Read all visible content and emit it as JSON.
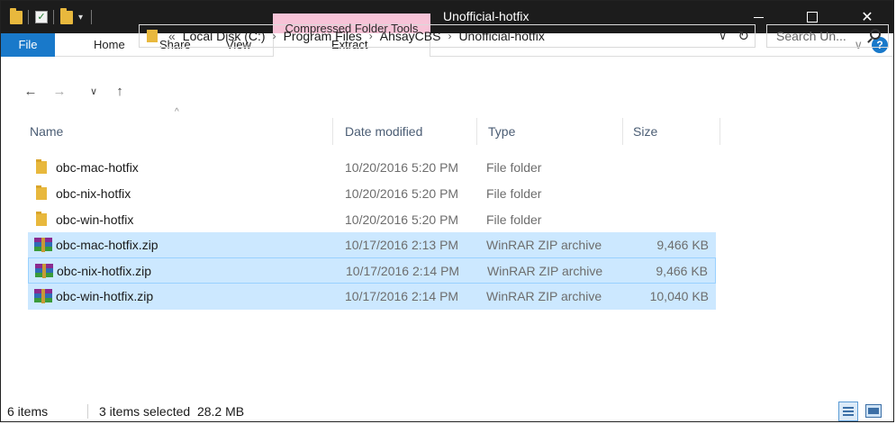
{
  "titlebar": {
    "context_tab_label": "Compressed Folder Tools",
    "window_title": "Unofficial-hotfix",
    "minimize_glyph": "",
    "maximize_glyph": "",
    "close_glyph": "✕"
  },
  "ribbon": {
    "tabs": [
      {
        "label": "File"
      },
      {
        "label": "Home"
      },
      {
        "label": "Share"
      },
      {
        "label": "View"
      },
      {
        "label": "Extract"
      }
    ],
    "expand_glyph": "∨",
    "help_glyph": "?"
  },
  "nav": {
    "back_glyph": "←",
    "forward_glyph": "→",
    "recent_glyph": "∨",
    "up_glyph": "↑",
    "overflow_glyph": "«",
    "breadcrumbs": [
      "Local Disk (C:)",
      "Program Files",
      "AhsayCBS",
      "Unofficial-hotfix"
    ],
    "crumb_sep": "›",
    "dropdown_glyph": "∨",
    "refresh_glyph": "↻",
    "search_placeholder": "Search Un..."
  },
  "columns": {
    "name": "Name",
    "date": "Date modified",
    "type": "Type",
    "size": "Size",
    "sort_glyph": "^"
  },
  "files": [
    {
      "name": "obc-mac-hotfix",
      "date": "10/20/2016 5:20 PM",
      "type": "File folder",
      "size": "",
      "icon": "folder-icon",
      "selected": false
    },
    {
      "name": "obc-nix-hotfix",
      "date": "10/20/2016 5:20 PM",
      "type": "File folder",
      "size": "",
      "icon": "folder-icon",
      "selected": false
    },
    {
      "name": "obc-win-hotfix",
      "date": "10/20/2016 5:20 PM",
      "type": "File folder",
      "size": "",
      "icon": "folder-icon",
      "selected": false
    },
    {
      "name": "obc-mac-hotfix.zip",
      "date": "10/17/2016 2:13 PM",
      "type": "WinRAR ZIP archive",
      "size": "9,466 KB",
      "icon": "winrar-archive-icon",
      "selected": true
    },
    {
      "name": "obc-nix-hotfix.zip",
      "date": "10/17/2016 2:14 PM",
      "type": "WinRAR ZIP archive",
      "size": "9,466 KB",
      "icon": "winrar-archive-icon",
      "selected": true
    },
    {
      "name": "obc-win-hotfix.zip",
      "date": "10/17/2016 2:14 PM",
      "type": "WinRAR ZIP archive",
      "size": "10,040 KB",
      "icon": "winrar-archive-icon",
      "selected": true
    }
  ],
  "status": {
    "item_count": "6 items",
    "selection": "3 items selected  28.2 MB"
  },
  "colors": {
    "titlebar_bg": "#1c1c1c",
    "context_tab_bg": "#f7c3d7",
    "file_tab_bg": "#1979ca",
    "selection_bg": "#cce8ff",
    "folder_color": "#e8b83d"
  }
}
